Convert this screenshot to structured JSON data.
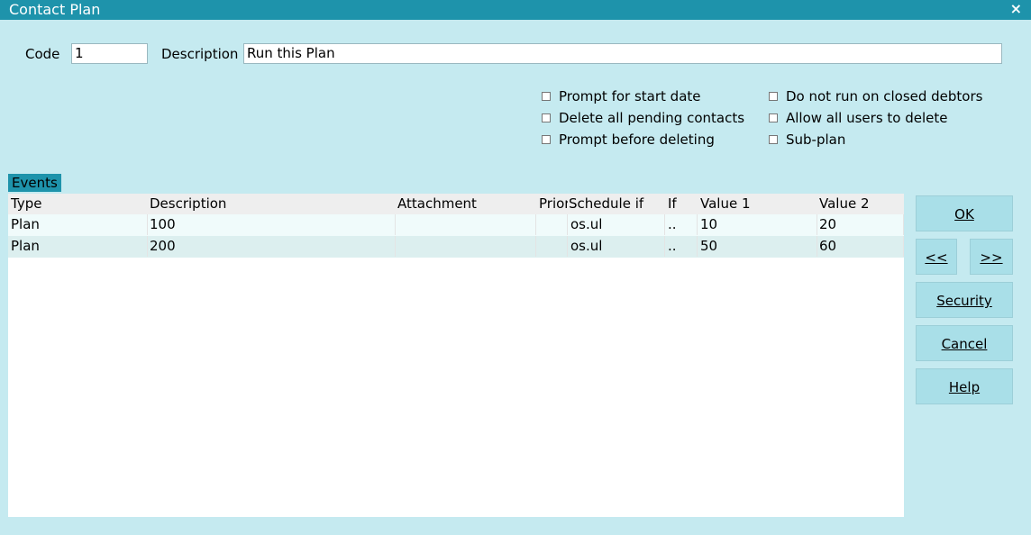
{
  "window": {
    "title": "Contact Plan",
    "close": "×"
  },
  "form": {
    "code_label": "Code",
    "code_value": "1",
    "description_label": "Description",
    "description_value": "Run this Plan"
  },
  "options": {
    "prompt_start_date": "Prompt for start date",
    "delete_pending": "Delete all pending contacts",
    "prompt_before_delete": "Prompt before deleting",
    "not_closed_debtors": "Do not run on closed debtors",
    "allow_all_delete": "Allow all users to delete",
    "sub_plan": "Sub-plan"
  },
  "events": {
    "tab_label": "Events",
    "columns": [
      "Type",
      "Description",
      "Attachment",
      "Priori",
      "Schedule if",
      "If",
      "Value 1",
      "Value 2"
    ],
    "rows": [
      [
        "Plan",
        "100",
        "",
        "",
        "os.ul",
        "..",
        "10",
        "20"
      ],
      [
        "Plan",
        "200",
        "",
        "",
        "os.ul",
        "..",
        "50",
        "60"
      ]
    ]
  },
  "buttons": {
    "ok": "OK",
    "prev": "<<",
    "next": ">>",
    "security": "Security",
    "cancel": "Cancel",
    "help": "Help"
  }
}
